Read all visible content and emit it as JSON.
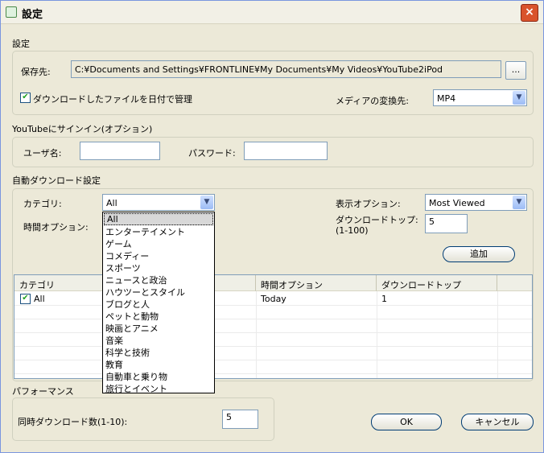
{
  "window": {
    "title": "設定",
    "close": "×"
  },
  "settings": {
    "group_label": "設定",
    "save_label": "保存先:",
    "save_path": "C:¥Documents and Settings¥FRONTLINE¥My Documents¥My Videos¥YouTube2iPod",
    "browse_label": "...",
    "date_manage_label": "ダウンロードしたファイルを日付で管理",
    "date_manage_checked": "✔",
    "media_label": "メディアの変換先:",
    "media_value": "MP4"
  },
  "signin": {
    "group_label": "YouTubeにサインイン(オプション)",
    "user_label": "ユーザ名:",
    "password_label": "パスワード:",
    "user_value": "",
    "password_value": ""
  },
  "auto": {
    "group_label": "自動ダウンロード設定",
    "category_label": "カテゴリ:",
    "category_value": "All",
    "time_label": "時間オプション:",
    "display_label": "表示オプション:",
    "display_value": "Most Viewed",
    "top_label_1": "ダウンロードトップ:",
    "top_label_2": "(1-100)",
    "top_value": "5",
    "add_label": "追加",
    "table": {
      "headers": [
        "カテゴリ",
        "時間オプション",
        "ダウンロードトップ"
      ],
      "rows": [
        {
          "category": "All",
          "time": "Today",
          "top": "1",
          "checked": "✔"
        }
      ]
    },
    "dropdown": [
      "All",
      "エンターテイメント",
      "ゲーム",
      "コメディー",
      "スポーツ",
      "ニュースと政治",
      "ハウツーとスタイル",
      "ブログと人",
      "ペットと動物",
      "映画とアニメ",
      "音楽",
      "科学と技術",
      "教育",
      "自動車と乗り物",
      "旅行とイベント"
    ]
  },
  "performance": {
    "group_label": "パフォーマンス",
    "concurrent_label": "同時ダウンロード数(1-10):",
    "concurrent_value": "5"
  },
  "footer": {
    "ok_label": "OK",
    "cancel_label": "キャンセル"
  },
  "icons": {
    "arrow": "▼"
  }
}
